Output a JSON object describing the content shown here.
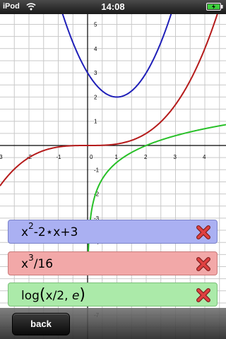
{
  "status_bar": {
    "carrier": "iPod",
    "time": "14:08"
  },
  "graph": {
    "x_ticks": [
      "-3",
      "-2",
      "-1",
      "0",
      "1",
      "2",
      "3",
      "4"
    ],
    "y_ticks": [
      "5",
      "4",
      "3",
      "2",
      "1",
      "-1",
      "-2",
      "-3",
      "-4",
      "-5",
      "-6",
      "-7"
    ]
  },
  "chart_data": {
    "type": "line",
    "xlim": [
      -3.1,
      4.7
    ],
    "ylim": [
      -7.4,
      5.2
    ],
    "grid": true,
    "series": [
      {
        "name": "x^2-2*x+3",
        "color": "#1f1fb8",
        "formula": "x*x-2*x+3"
      },
      {
        "name": "x^3/16",
        "color": "#b51b1b",
        "formula": "x*x*x/16"
      },
      {
        "name": "log(x/2, e)",
        "color": "#28c028",
        "formula": "log(x/2)"
      }
    ]
  },
  "functions": [
    {
      "base": "x",
      "sup": "2",
      "rest": "-2⋆x+3",
      "color": "#aab0f2"
    },
    {
      "base": "x",
      "sup": "3",
      "rest": "/16",
      "color": "#f2a8a8"
    },
    {
      "prefix": "log",
      "open": "(",
      "arg": "x/2,",
      "e": "e",
      "close": ")",
      "color": "#abeaa9"
    }
  ],
  "toolbar": {
    "back_label": "back"
  },
  "icons": {
    "delete": "delete-x-icon",
    "wifi": "wifi-icon",
    "battery": "battery-icon"
  }
}
